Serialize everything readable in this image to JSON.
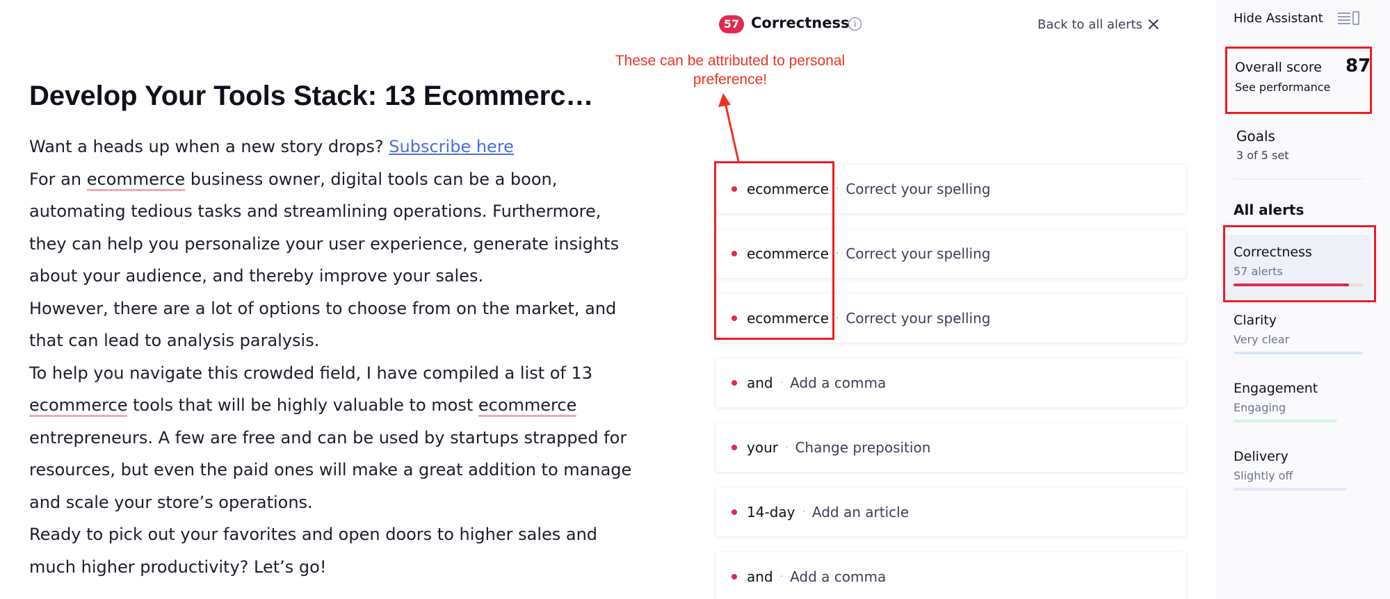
{
  "document": {
    "title": "Develop Your Tools Stack: 13 Ecommerc…",
    "paragraphs": {
      "p1": {
        "before": "Want a heads up when a new story drops? ",
        "link": "Subscribe here"
      },
      "p2": {
        "before": "For an ",
        "err1": "ecommerce",
        "after": " business owner, digital tools can be a boon, automating tedious tasks and streamlining operations. Furthermore, they can help you personalize your user experience, generate insights about your audience, and thereby improve your sales."
      },
      "p3": "However, there are a lot of options to choose from on the market, and that can lead to analysis paralysis.",
      "p4": {
        "before": "To help you navigate this crowded field, I have compiled a list of 13 ",
        "err1": "ecommerce",
        "mid": " tools that will be highly valuable to most ",
        "err2": "ecommerce",
        "after": " entrepreneurs. A few are free and can be used by startups strapped for resources, but even the paid ones will make a great addition to manage and scale your store’s operations."
      },
      "p5": "Ready to pick out your favorites and open doors to higher sales and much higher productivity? Let’s go!"
    }
  },
  "panel": {
    "score": "57",
    "title": "Correctness",
    "info_icon": "info-icon",
    "back_label": "Back to all alerts",
    "close_icon": "×"
  },
  "annotation": "These can be attributed to personal preference!",
  "alerts": [
    {
      "word": "ecommerce",
      "action": "Correct your spelling"
    },
    {
      "word": "ecommerce",
      "action": "Correct your spelling"
    },
    {
      "word": "ecommerce",
      "action": "Correct your spelling"
    },
    {
      "word": "and",
      "action": "Add a comma"
    },
    {
      "word": "your",
      "action": "Change preposition"
    },
    {
      "word": "14-day",
      "action": "Add an article"
    },
    {
      "word": "and",
      "action": "Add a comma"
    }
  ],
  "alert_separator": "·",
  "sidebar": {
    "hide_assistant": "Hide Assistant",
    "overall_label": "Overall score",
    "overall_value": "87",
    "see_performance": "See performance",
    "goals_title": "Goals",
    "goals_sub": "3 of 5 set",
    "all_alerts": "All alerts",
    "categories": [
      {
        "title": "Correctness",
        "sub": "57 alerts",
        "color": "#e0294c",
        "progress": 0.89
      },
      {
        "title": "Clarity",
        "sub": "Very clear",
        "color": "#dbe4fb",
        "progress": 1.0
      },
      {
        "title": "Engagement",
        "sub": "Engaging",
        "color": "#d3f1e8",
        "progress": 0.8
      },
      {
        "title": "Delivery",
        "sub": "Slightly off",
        "color": "#ece0fb",
        "progress": 0.87
      }
    ]
  },
  "colors": {
    "accent_red": "#e0294c",
    "annotation_red": "#ee3224",
    "link_blue": "#4a6ee0",
    "error_underline": "#f3a6b4"
  }
}
